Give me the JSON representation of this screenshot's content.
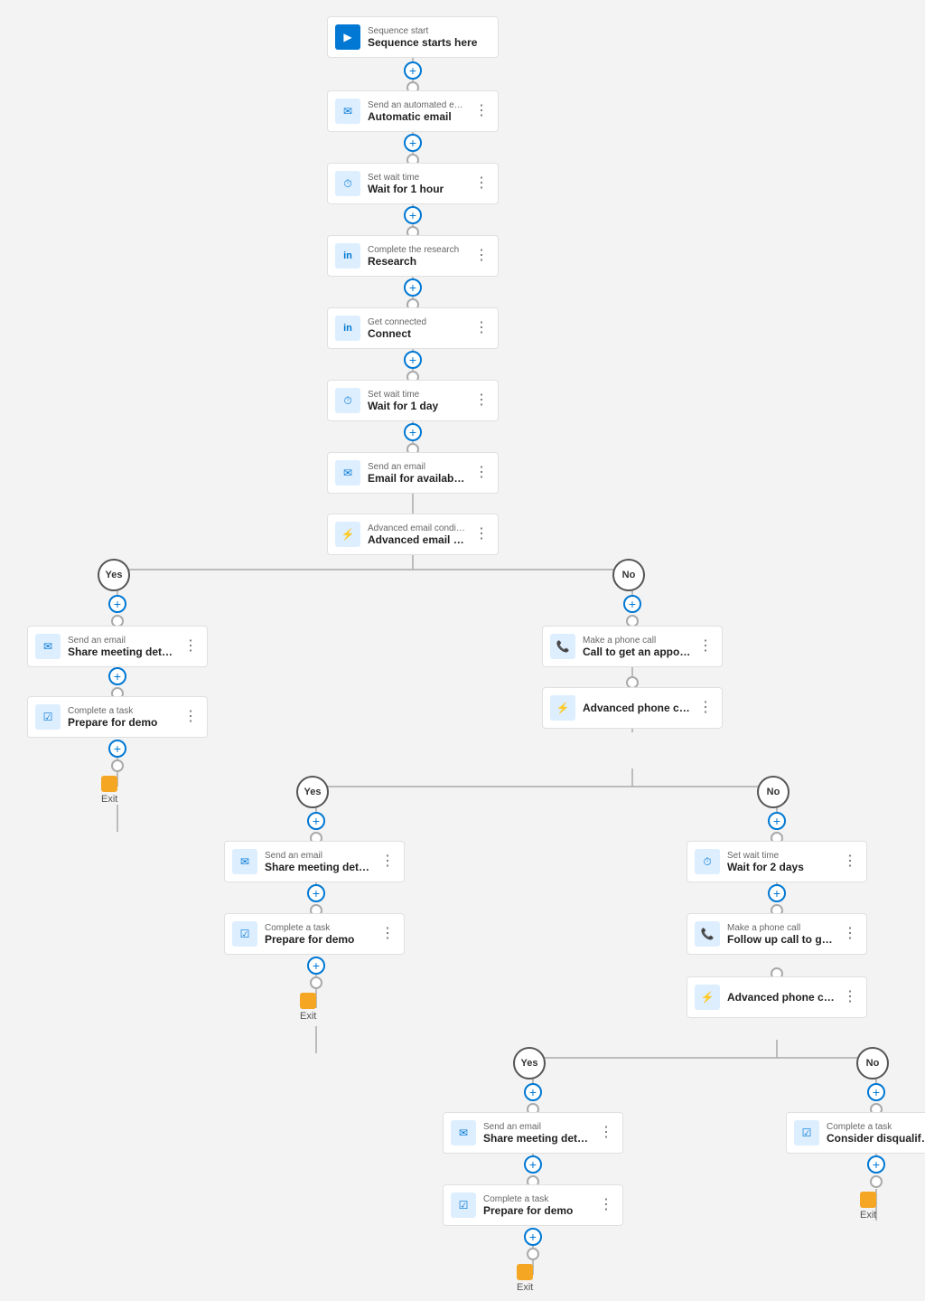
{
  "nodes": {
    "sequence_start": {
      "subtitle": "Sequence start",
      "title": "Sequence starts here",
      "icon": "▶"
    },
    "automatic_email": {
      "subtitle": "Send an automated email",
      "title": "Automatic email",
      "icon": "✉"
    },
    "wait_1hour": {
      "subtitle": "Set wait time",
      "title": "Wait for 1 hour",
      "icon": "⏱"
    },
    "research": {
      "subtitle": "Complete the research",
      "title": "Research",
      "icon": "in"
    },
    "connect": {
      "subtitle": "Get connected",
      "title": "Connect",
      "icon": "in"
    },
    "wait_1day": {
      "subtitle": "Set wait time",
      "title": "Wait for 1 day",
      "icon": "⏱"
    },
    "email_timeslots": {
      "subtitle": "Send an email",
      "title": "Email for available time slots",
      "icon": "✉"
    },
    "advanced_email_conditions": {
      "subtitle": "Advanced email conditions",
      "title": "Advanced email conditions",
      "icon": "⚡"
    },
    "yes_label_1": "Yes",
    "no_label_1": "No",
    "share_meeting_yes": {
      "subtitle": "Send an email",
      "title": "Share meeting details",
      "icon": "✉"
    },
    "prepare_demo_yes": {
      "subtitle": "Complete a task",
      "title": "Prepare for demo",
      "icon": "☑"
    },
    "call_appointment": {
      "subtitle": "Make a phone call",
      "title": "Call to get an appointment",
      "icon": "📞"
    },
    "advanced_phone_condition_1": {
      "subtitle": "",
      "title": "Advanced phone condition",
      "icon": "⚡"
    },
    "yes_label_2": "Yes",
    "no_label_2": "No",
    "share_meeting_yes2": {
      "subtitle": "Send an email",
      "title": "Share meeting details",
      "icon": "✉"
    },
    "prepare_demo_yes2": {
      "subtitle": "Complete a task",
      "title": "Prepare for demo",
      "icon": "☑"
    },
    "wait_2days": {
      "subtitle": "Set wait time",
      "title": "Wait for 2 days",
      "icon": "⏱"
    },
    "followup_call": {
      "subtitle": "Make a phone call",
      "title": "Follow up call to get an appointment",
      "icon": "📞"
    },
    "advanced_phone_condition_2": {
      "subtitle": "",
      "title": "Advanced phone condition",
      "icon": "⚡"
    },
    "yes_label_3": "Yes",
    "no_label_3": "No",
    "share_meeting_yes3": {
      "subtitle": "Send an email",
      "title": "Share meeting details",
      "icon": "✉"
    },
    "disqualify": {
      "subtitle": "Complete a task",
      "title": "Consider disqualifying the customer",
      "icon": "☑"
    },
    "prepare_demo_yes3": {
      "subtitle": "Complete a task",
      "title": "Prepare for demo",
      "icon": "☑"
    },
    "exit_label": "Exit",
    "more_icon": "⋮"
  }
}
